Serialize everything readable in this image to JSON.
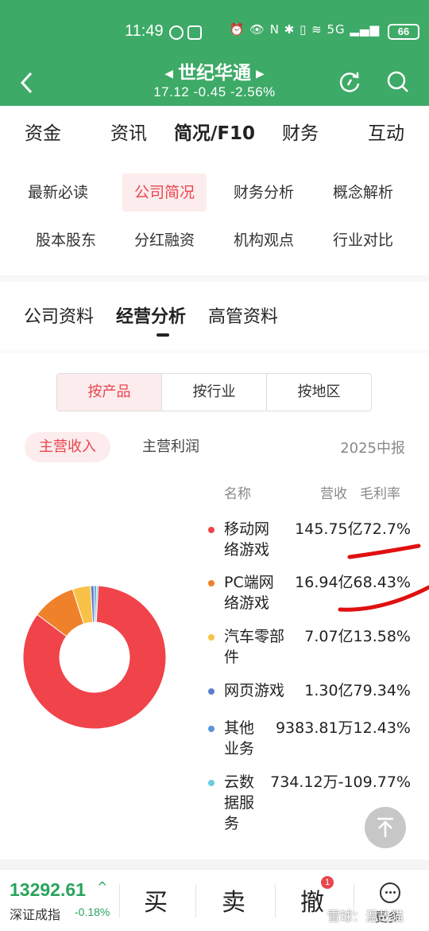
{
  "status_bar": {
    "time": "11:49",
    "battery": "66",
    "icons_text": "⏰ 👁 N ✱ ▯ ≋ 5G ▂▄▆"
  },
  "header": {
    "title": "世纪华通",
    "quote": "17.12 -0.45 -2.56%",
    "colors": {
      "brand_green": "#3daa67",
      "accent_red": "#e8454d"
    }
  },
  "main_tabs": [
    {
      "label": "资金"
    },
    {
      "label": "资讯"
    },
    {
      "label": "简况/F10"
    },
    {
      "label": "财务"
    },
    {
      "label": "互动"
    }
  ],
  "sub_tabs": [
    {
      "label": "最新必读"
    },
    {
      "label": "公司简况"
    },
    {
      "label": "财务分析"
    },
    {
      "label": "概念解析"
    },
    {
      "label": "股本股东"
    },
    {
      "label": "分红融资"
    },
    {
      "label": "机构观点"
    },
    {
      "label": "行业对比"
    }
  ],
  "section_tabs": [
    {
      "label": "公司资料"
    },
    {
      "label": "经营分析"
    },
    {
      "label": "高管资料"
    }
  ],
  "segment": [
    {
      "label": "按产品"
    },
    {
      "label": "按行业"
    },
    {
      "label": "按地区"
    }
  ],
  "pills": {
    "active": "主营收入",
    "inactive": "主营利润"
  },
  "period": "2025中报",
  "legend_header": {
    "name": "名称",
    "revenue": "营收",
    "margin": "毛利率"
  },
  "chart_data": {
    "type": "pie",
    "style": "donut",
    "categories": [
      "移动网络游戏",
      "PC端网络游戏",
      "汽车零部件",
      "网页游戏",
      "其他业务",
      "云数据服务"
    ],
    "series": [
      {
        "values_yi": [
          145.75,
          16.94,
          7.07,
          1.3,
          0.938381,
          0.073412
        ],
        "revenue_labels": [
          "145.75亿",
          "16.94亿",
          "7.07亿",
          "1.30亿",
          "9383.81万",
          "734.12万"
        ],
        "gross_margin_labels": [
          "72.7%",
          "68.43%",
          "13.58%",
          "79.34%",
          "12.43%",
          "-109.77%"
        ]
      }
    ],
    "colors": [
      "#f0434a",
      "#f0812b",
      "#f8c249",
      "#5b7fcc",
      "#5a95d9",
      "#6ccbe0"
    ],
    "legend_lines": [
      [
        "移动网",
        "络游戏"
      ],
      [
        "PC端网",
        "络游戏"
      ],
      [
        "汽车零部",
        "件"
      ],
      [
        "网页游戏"
      ],
      [
        "其他",
        "业务"
      ],
      [
        "云数",
        "据服",
        "务"
      ]
    ]
  },
  "bottom_bar": {
    "index_value": "13292.61",
    "index_name": "深证成指",
    "index_change": "-0.18%",
    "buy": "买",
    "sell": "卖",
    "cancel": "撤",
    "cancel_badge": "1",
    "more": "更多"
  },
  "watermark": "雪球：温故猫"
}
